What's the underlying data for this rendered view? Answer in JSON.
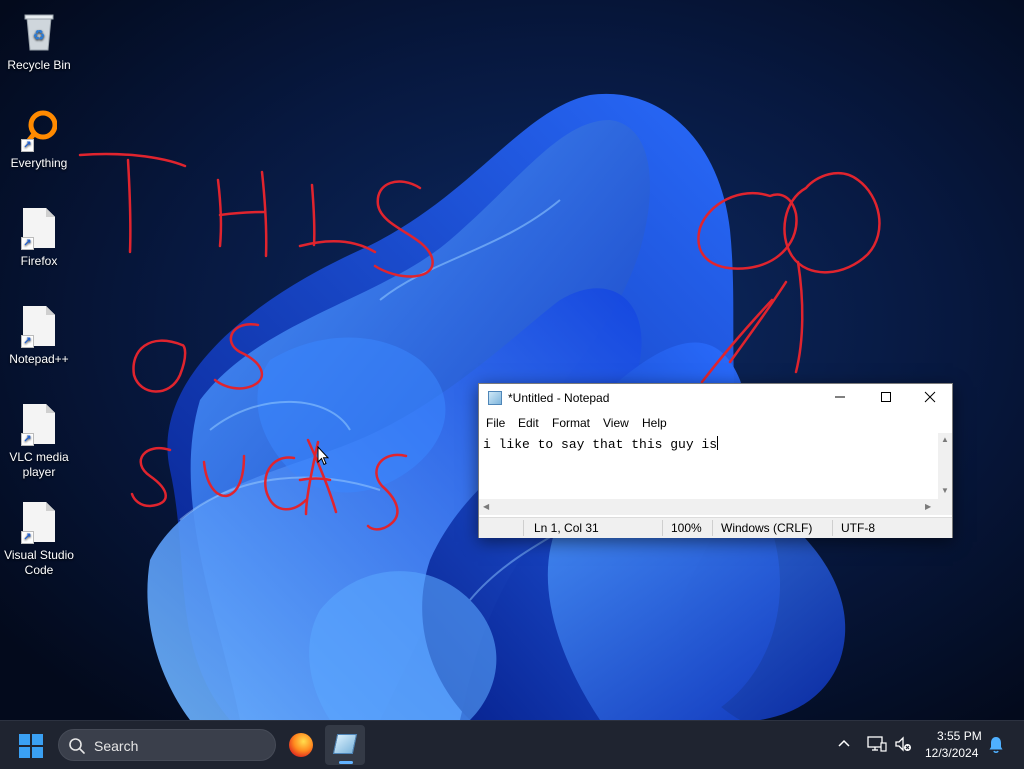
{
  "desktop": {
    "icons": [
      {
        "label": "Recycle Bin",
        "icon": "recycle-bin-icon"
      },
      {
        "label": "Everything",
        "icon": "magnifier-icon"
      },
      {
        "label": "Firefox",
        "icon": "file-icon"
      },
      {
        "label": "Notepad++",
        "icon": "file-icon"
      },
      {
        "label": "VLC media player",
        "icon": "file-icon"
      },
      {
        "label": "Visual Studio Code",
        "icon": "file-icon"
      }
    ],
    "annotation_color": "#e0242e"
  },
  "notepad": {
    "title": "*Untitled - Notepad",
    "menu": [
      "File",
      "Edit",
      "Format",
      "View",
      "Help"
    ],
    "content": "i like to say that this guy is",
    "status": {
      "position": "Ln 1, Col 31",
      "zoom": "100%",
      "line_ending": "Windows (CRLF)",
      "encoding": "UTF-8"
    }
  },
  "taskbar": {
    "search_label": "Search",
    "time": "3:55 PM",
    "date": "12/3/2024",
    "accent": "#3aa0f3"
  }
}
